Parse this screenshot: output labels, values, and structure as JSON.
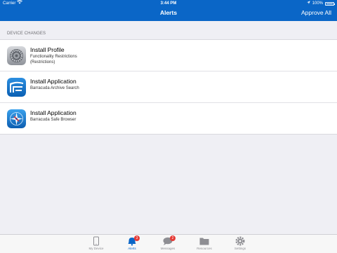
{
  "status_bar": {
    "carrier": "Carrier",
    "time": "3:44 PM",
    "battery": "100%"
  },
  "nav": {
    "title": "Alerts",
    "action": "Approve All"
  },
  "section_header": "DEVICE CHANGES",
  "items": [
    {
      "title": "Install Profile",
      "line1": "Functionality Restrictions",
      "line2": "(Restrictions)",
      "icon": "settings-gear-icon"
    },
    {
      "title": "Install Application",
      "line1": "Barracuda Archive Search",
      "line2": "",
      "icon": "archive-search-app-icon"
    },
    {
      "title": "Install Application",
      "line1": "Barracuda Safe Browser",
      "line2": "",
      "icon": "safe-browser-compass-icon"
    }
  ],
  "tabs": [
    {
      "label": "My Device",
      "icon": "device-icon",
      "badge": ""
    },
    {
      "label": "Alerts",
      "icon": "bell-icon",
      "badge": "3"
    },
    {
      "label": "Messages",
      "icon": "chat-bubble-icon",
      "badge": "2"
    },
    {
      "label": "Resources",
      "icon": "folder-icon",
      "badge": ""
    },
    {
      "label": "Settings",
      "icon": "gear-icon",
      "badge": ""
    }
  ],
  "colors": {
    "brand": "#0a66c7",
    "badge": "#e53935",
    "background": "#efeff4"
  }
}
